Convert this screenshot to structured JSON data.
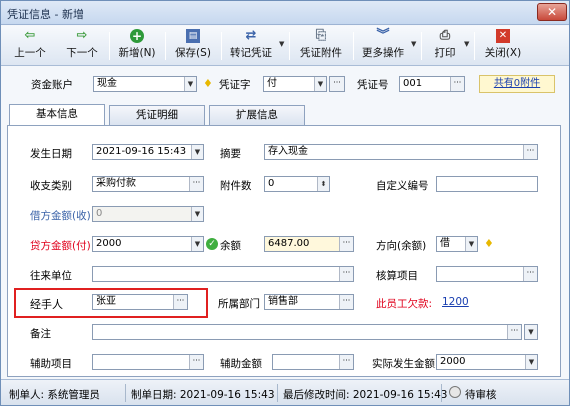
{
  "window": {
    "title": "凭证信息 - 新增",
    "close_label": "✕"
  },
  "toolbar": {
    "prev": "上一个",
    "next": "下一个",
    "add": "新增(N)",
    "save": "保存(S)",
    "post": "转记凭证",
    "attach": "凭证附件",
    "more": "更多操作",
    "print": "打印",
    "close": "关闭(X)"
  },
  "header": {
    "account_label": "资金账户",
    "account_value": "现金",
    "voucher_word_label": "凭证字",
    "voucher_word_value": "付",
    "voucher_no_label": "凭证号",
    "voucher_no_value": "001",
    "attach_link": "共有0附件"
  },
  "tabs": [
    "基本信息",
    "凭证明细",
    "扩展信息"
  ],
  "form": {
    "date_label": "发生日期",
    "date_value": "2021-09-16 15:43",
    "summary_label": "摘要",
    "summary_value": "存入现金",
    "category_label": "收支类别",
    "category_value": "采购付款",
    "attachments_label": "附件数",
    "attachments_value": "0",
    "custom_no_label": "自定义编号",
    "custom_no_value": "",
    "debit_label": "借方金额(收)",
    "debit_value": "0",
    "credit_label": "贷方金额(付)",
    "credit_value": "2000",
    "balance_label": "余额",
    "balance_value": "6487.00",
    "direction_label": "方向(余额)",
    "direction_value": "借",
    "partner_label": "往来单位",
    "partner_value": "",
    "check_item_label": "核算项目",
    "check_item_value": "",
    "handler_label": "经手人",
    "handler_value": "张亚",
    "dept_label": "所属部门",
    "dept_value": "销售部",
    "owed_label": "此员工欠款:",
    "owed_value": "1200",
    "remark_label": "备注",
    "remark_value": "",
    "aux_item_label": "辅助项目",
    "aux_item_value": "",
    "aux_amount_label": "辅助金额",
    "aux_amount_value": "",
    "actual_amount_label": "实际发生金额",
    "actual_amount_value": "2000"
  },
  "status": {
    "maker": "制单人: 系统管理员",
    "make_date": "制单日期: 2021-09-16 15:43",
    "modified": "最后修改时间: 2021-09-16 15:43",
    "audit": "待审核"
  }
}
